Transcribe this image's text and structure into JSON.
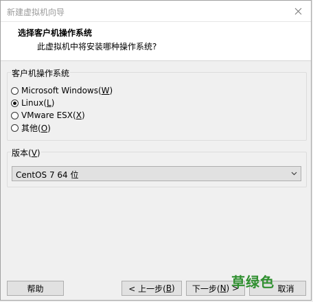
{
  "window": {
    "title": "新建虚拟机向导"
  },
  "header": {
    "title": "选择客户机操作系统",
    "subtitle": "此虚拟机中将安装哪种操作系统?"
  },
  "os_group": {
    "legend": "客户机操作系统",
    "options": [
      {
        "label": "Microsoft Windows(",
        "mnemonic": "W",
        "suffix": ")",
        "checked": false
      },
      {
        "label": "Linux(",
        "mnemonic": "L",
        "suffix": ")",
        "checked": true
      },
      {
        "label": "VMware ESX(",
        "mnemonic": "X",
        "suffix": ")",
        "checked": false
      },
      {
        "label": "其他(",
        "mnemonic": "O",
        "suffix": ")",
        "checked": false
      }
    ]
  },
  "version_group": {
    "legend": "版本(",
    "legend_mnemonic": "V",
    "legend_suffix": ")",
    "selected": "CentOS 7 64 位"
  },
  "buttons": {
    "help": "帮助",
    "back": "< 上一步(",
    "back_mnemonic": "B",
    "back_suffix": ")",
    "next": "下一步(",
    "next_mnemonic": "N",
    "next_suffix": ") >",
    "cancel": "取消"
  },
  "watermark": "草绿色"
}
